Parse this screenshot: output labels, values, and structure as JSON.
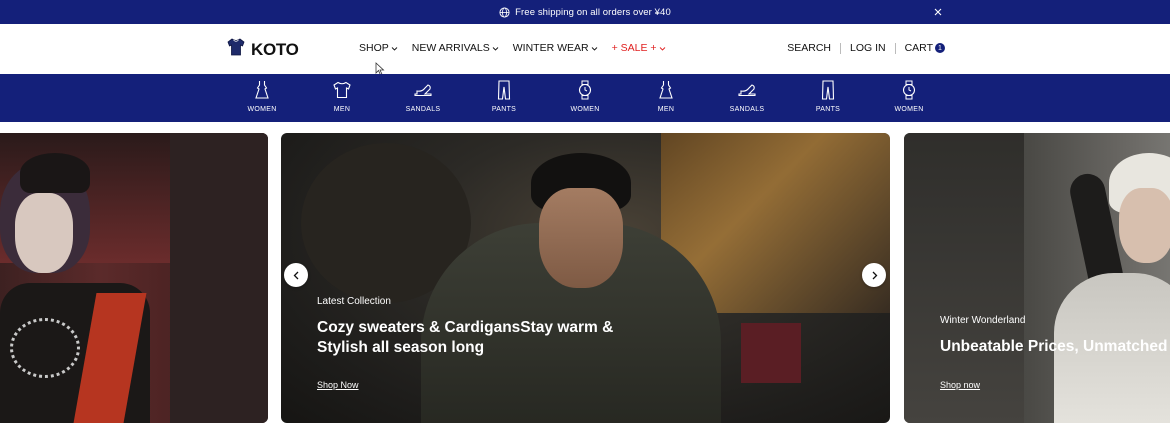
{
  "announcement": {
    "text": "Free shipping on all orders over ¥40",
    "icon": "globe-icon",
    "close_icon": "close-icon"
  },
  "header": {
    "logo_text": "KOTO",
    "logo_icon": "tshirt-icon",
    "nav": [
      {
        "label": "SHOP"
      },
      {
        "label": "NEW ARRIVALS"
      },
      {
        "label": "WINTER WEAR"
      },
      {
        "label": "+ SALE +"
      }
    ],
    "search_label": "SEARCH",
    "login_label": "LOG IN",
    "cart_label": "CART",
    "cart_count": "1"
  },
  "categories": [
    {
      "label": "WOMEN",
      "icon": "dress-icon"
    },
    {
      "label": "MEN",
      "icon": "tshirt-icon"
    },
    {
      "label": "SANDALS",
      "icon": "heel-icon"
    },
    {
      "label": "PANTS",
      "icon": "pants-icon"
    },
    {
      "label": "WOMEN",
      "icon": "watch-icon"
    },
    {
      "label": "MEN",
      "icon": "dress-icon"
    },
    {
      "label": "SANDALS",
      "icon": "heel-icon"
    },
    {
      "label": "PANTS",
      "icon": "pants-icon"
    },
    {
      "label": "WOMEN",
      "icon": "watch-icon"
    }
  ],
  "slides": {
    "center": {
      "subtitle": "Latest Collection",
      "headline_line1": "Cozy sweaters & CardigansStay warm &",
      "headline_line2": "Stylish all season long",
      "cta": "Shop Now"
    },
    "right": {
      "subtitle": "Winter Wonderland",
      "headline": "Unbeatable Prices, Unmatched Quality",
      "cta": "Shop now"
    }
  },
  "colors": {
    "brand_navy": "#14207a",
    "sale_red": "#e02020"
  }
}
